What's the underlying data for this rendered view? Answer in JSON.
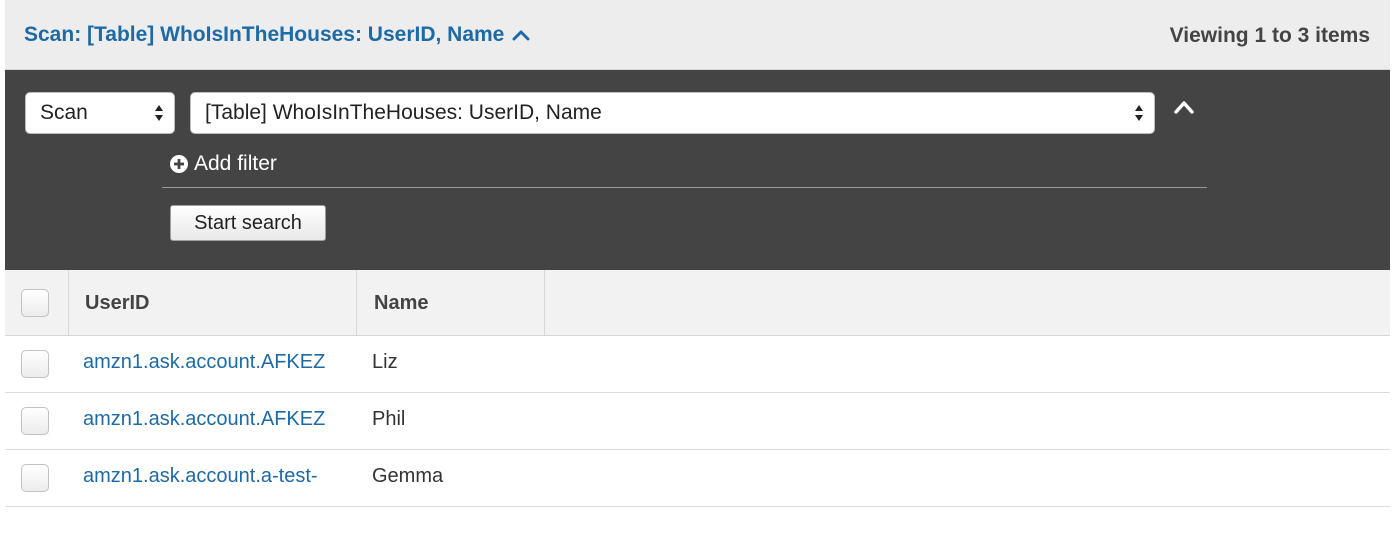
{
  "header": {
    "title": "Scan: [Table] WhoIsInTheHouses: UserID, Name",
    "count": "Viewing 1 to 3 items"
  },
  "query": {
    "operation": "Scan",
    "target": "[Table] WhoIsInTheHouses: UserID, Name",
    "add_filter_label": "Add filter",
    "start_search_label": "Start search"
  },
  "table": {
    "columns": [
      "UserID",
      "Name"
    ],
    "rows": [
      {
        "user_id": "amzn1.ask.account.AFKEZ",
        "name": "Liz"
      },
      {
        "user_id": "amzn1.ask.account.AFKEZ",
        "name": "Phil"
      },
      {
        "user_id": "amzn1.ask.account.a-test-",
        "name": "Gemma"
      }
    ]
  },
  "icons": {
    "header_toggle": "chevron-up-icon",
    "panel_collapse": "chevron-up-icon",
    "add_filter": "plus-circle-icon",
    "select": "up-down-arrows-icon"
  },
  "colors": {
    "link": "#1d6aa5",
    "panel": "#444444",
    "header_bg": "#ededed"
  }
}
